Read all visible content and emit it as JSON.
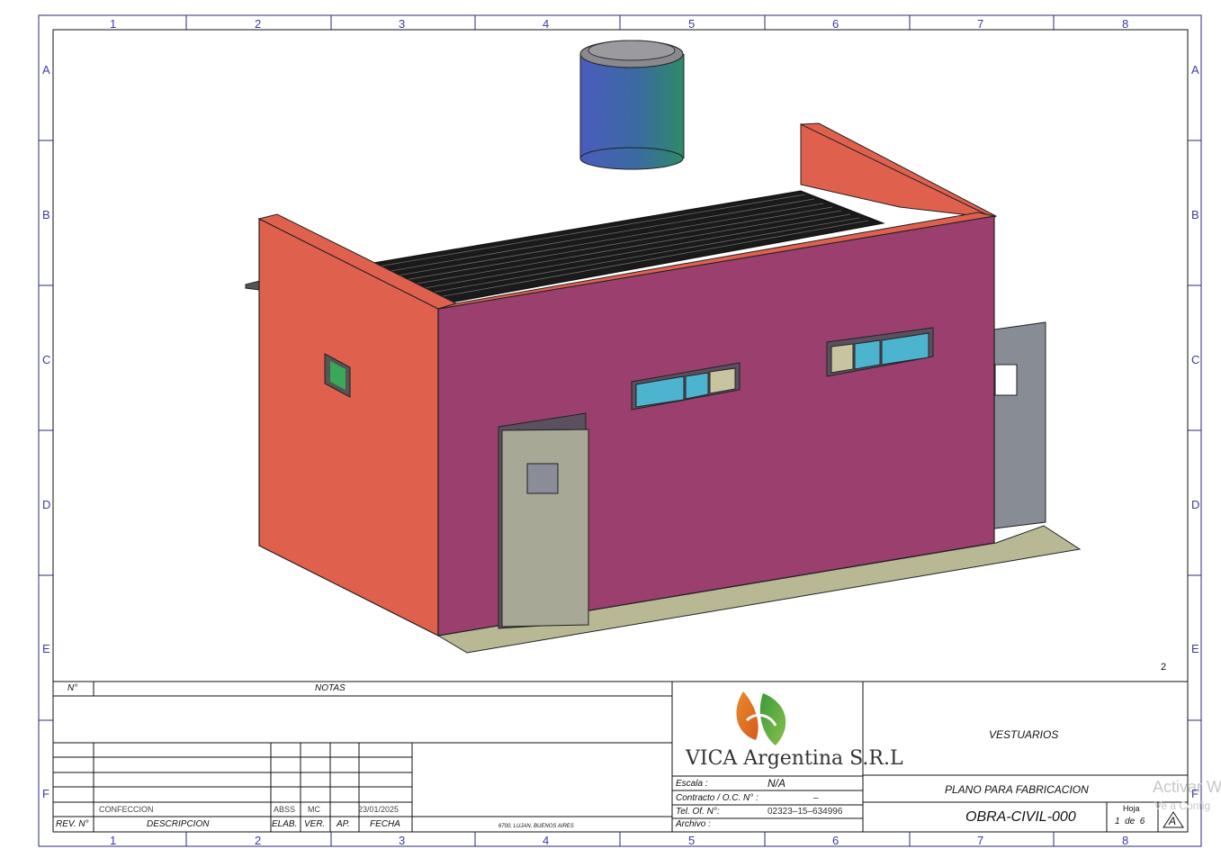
{
  "grid": {
    "columns": [
      "1",
      "2",
      "3",
      "4",
      "5",
      "6",
      "7",
      "8"
    ],
    "rows": [
      "A",
      "B",
      "C",
      "D",
      "E",
      "F"
    ]
  },
  "view_number": "2",
  "notes": {
    "col_number": "N°",
    "col_notes": "NOTAS"
  },
  "revisions": {
    "headers": {
      "rev": "REV. N°",
      "description": "DESCRIPCION",
      "elab": "ELAB.",
      "ver": "VER.",
      "ap": "AP.",
      "date": "FECHA"
    },
    "row": {
      "description": "CONFECCION",
      "elab": "ABSS",
      "ver": "MC",
      "date": "23/01/2025"
    }
  },
  "address": "6700, LUJAN, BUENOS AIRES",
  "company": {
    "name": "VICA Argentina S.R.L",
    "logo": "leaf-logo"
  },
  "info": {
    "scale_label": "Escala :",
    "scale_value": "N/A",
    "contract_label": "Contracto / O.C. N° :",
    "contract_value": "–",
    "phone_label": "Tel. Of. N°:",
    "phone_value": "02323–15–634996",
    "file_label": "Archivo :"
  },
  "title": "VESTUARIOS",
  "subtitle": "PLANO PARA FABRICACION",
  "drawing_code": "OBRA-CIVIL-000",
  "sheet": {
    "label": "Hoja",
    "of_text": "1  de  6",
    "revision": "A"
  },
  "watermark": {
    "line1": "Activar W",
    "line2": "Ve a Config"
  },
  "colors": {
    "wall_side": "#e0604e",
    "wall_front": "#9b3f6f",
    "door": "#a8a896",
    "floor": "#b8b894",
    "rear_panel": "#888c94",
    "glass": "#4db4d0",
    "tank_top": "#8a8a8e",
    "grid_text": "#3a3aa8"
  }
}
